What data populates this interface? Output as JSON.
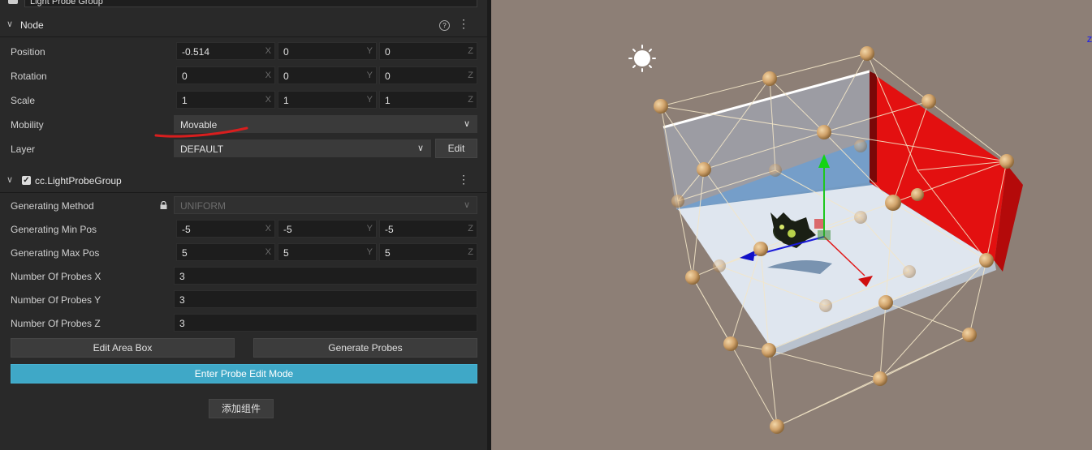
{
  "top_field": {
    "name": "Light Probe Group"
  },
  "node": {
    "title": "Node",
    "fields": {
      "position": {
        "label": "Position",
        "x": "-0.514",
        "y": "0",
        "z": "0"
      },
      "rotation": {
        "label": "Rotation",
        "x": "0",
        "y": "0",
        "z": "0"
      },
      "scale": {
        "label": "Scale",
        "x": "1",
        "y": "1",
        "z": "1"
      },
      "mobility": {
        "label": "Mobility",
        "value": "Movable"
      },
      "layer": {
        "label": "Layer",
        "value": "DEFAULT",
        "edit_label": "Edit"
      }
    }
  },
  "axis_labels": {
    "x": "X",
    "y": "Y",
    "z": "Z"
  },
  "component": {
    "title": "cc.LightProbeGroup",
    "method": {
      "label": "Generating Method",
      "value": "UNIFORM"
    },
    "min_pos": {
      "label": "Generating Min Pos",
      "x": "-5",
      "y": "-5",
      "z": "-5"
    },
    "max_pos": {
      "label": "Generating Max Pos",
      "x": "5",
      "y": "5",
      "z": "5"
    },
    "probes_x": {
      "label": "Number Of Probes X",
      "value": "3"
    },
    "probes_y": {
      "label": "Number Of Probes Y",
      "value": "3"
    },
    "probes_z": {
      "label": "Number Of Probes Z",
      "value": "3"
    },
    "edit_area_label": "Edit Area Box",
    "generate_label": "Generate Probes",
    "enter_edit_label": "Enter Probe Edit Mode"
  },
  "add_component_label": "添加组件",
  "scene": {
    "gizmo_axis": "Z"
  },
  "colors": {
    "accent": "#3fa8c7",
    "annotation": "#d81e1e",
    "scene_bg": "#8d7f76",
    "probe": "#d8b07a",
    "wall_red": "#e31010"
  }
}
